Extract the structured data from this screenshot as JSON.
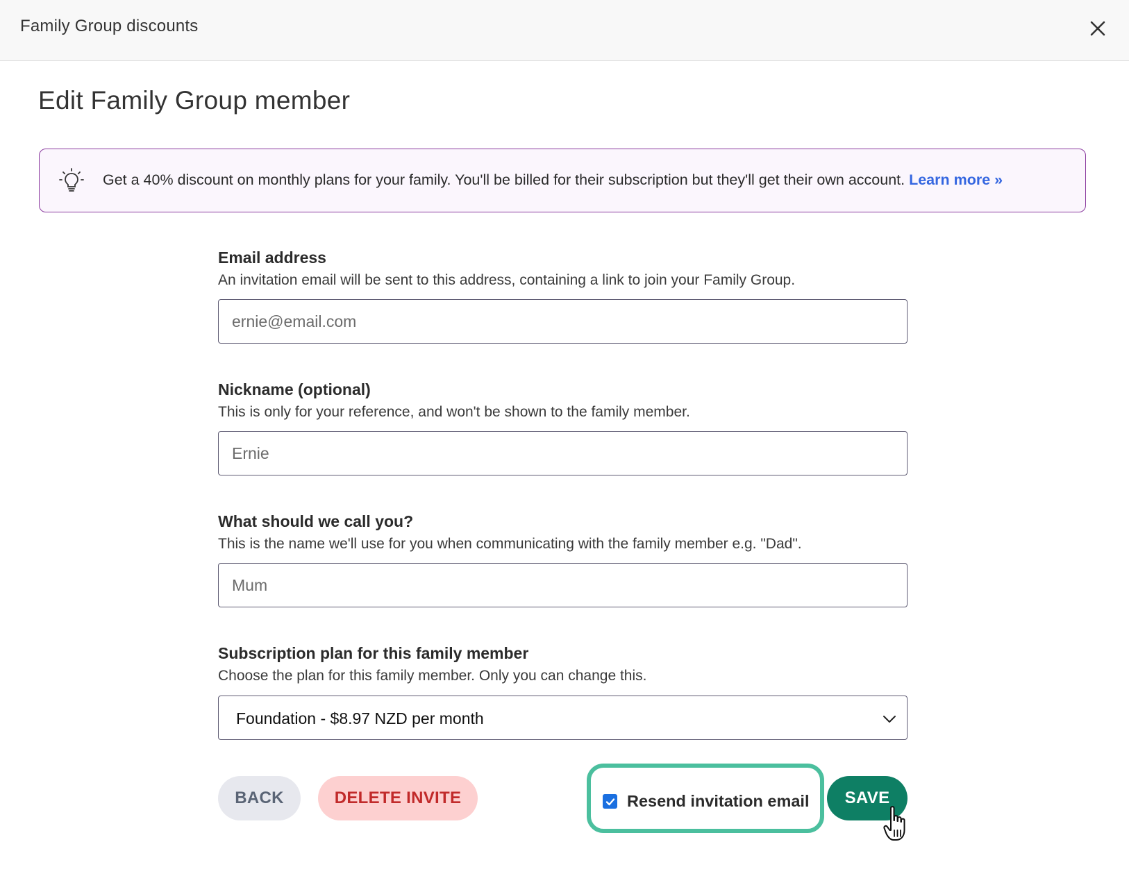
{
  "header": {
    "title": "Family Group discounts",
    "close_icon": "close-icon"
  },
  "page": {
    "title": "Edit Family Group member"
  },
  "banner": {
    "icon": "lightbulb-icon",
    "text": "Get a 40% discount on monthly plans for your family. You'll be billed for their subscription but they'll get their own account. ",
    "link_label": "Learn more »",
    "border_color": "#8a3a9e",
    "link_color": "#3466e0"
  },
  "form": {
    "email": {
      "label": "Email address",
      "help": "An invitation email will be sent to this address, containing a link to join your Family Group.",
      "placeholder": "ernie@email.com",
      "value": ""
    },
    "nickname": {
      "label": "Nickname (optional)",
      "help": "This is only for your reference, and won't be shown to the family member.",
      "placeholder": "Ernie",
      "value": ""
    },
    "call_you": {
      "label": "What should we call you?",
      "help": "This is the name we'll use for you when communicating with the family member e.g. \"Dad\".",
      "placeholder": "Mum",
      "value": ""
    },
    "plan": {
      "label": "Subscription plan for this family member",
      "help": "Choose the plan for this family member. Only you can change this.",
      "selected": "Foundation - $8.97 NZD per month",
      "chevron_icon": "chevron-down-icon"
    }
  },
  "actions": {
    "back_label": "BACK",
    "delete_label": "DELETE INVITE",
    "resend_label": "Resend invitation email",
    "resend_checked": true,
    "save_label": "SAVE",
    "save_color": "#0e7f64",
    "delete_color": "#c12a2a",
    "highlight_color": "#4bbf9e"
  },
  "cursor": {
    "icon": "hand-pointer-icon"
  }
}
